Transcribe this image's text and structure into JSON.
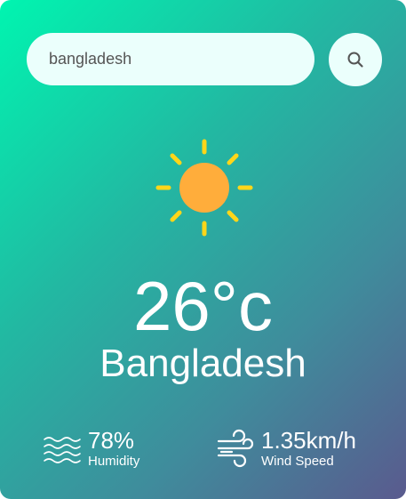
{
  "search": {
    "value": "bangladesh"
  },
  "icons": {
    "search_button": "search-icon",
    "weather": "sun-icon",
    "humidity": "waves-icon",
    "wind": "wind-icon"
  },
  "weather": {
    "temperature": "26°c",
    "city": "Bangladesh"
  },
  "details": {
    "humidity": {
      "value": "78%",
      "label": "Humidity"
    },
    "wind": {
      "value": "1.35km/h",
      "label": "Wind Speed"
    }
  },
  "colors": {
    "gradient_start": "#00f5b0",
    "gradient_end": "#5a5a8e",
    "input_background": "#ebfffc",
    "sun_core": "#ffad3b",
    "sun_rays": "#ffd619"
  }
}
